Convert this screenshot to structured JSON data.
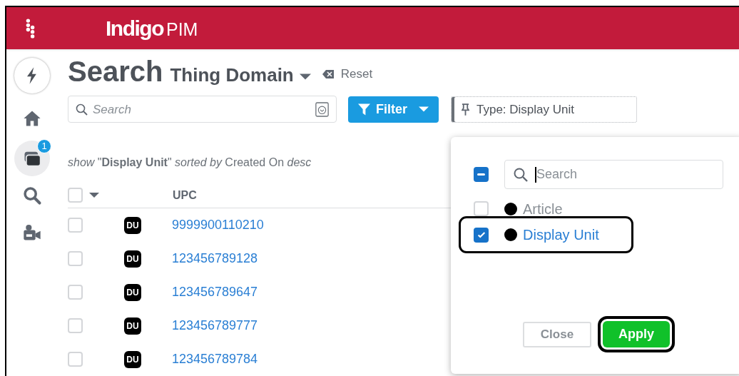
{
  "header": {
    "logo": "Indigo",
    "product": "PIM"
  },
  "sidebar": {
    "items": [
      {
        "kind": "bolt",
        "selected": false
      },
      {
        "kind": "home",
        "selected": false
      },
      {
        "kind": "cards",
        "selected": true,
        "badge": "1"
      },
      {
        "kind": "search",
        "selected": false
      },
      {
        "kind": "camera",
        "selected": false
      }
    ]
  },
  "page": {
    "title": "Search",
    "domain": "Thing Domain",
    "reset": "Reset"
  },
  "search": {
    "placeholder": "Search"
  },
  "filter_button": "Filter",
  "filter_chip": "Type: Display Unit",
  "summary": "*show* \"**Display Unit**\" *sorted by* Created On *desc*",
  "table": {
    "select_all_checked": false,
    "columns": [
      "UPC"
    ],
    "rows": [
      {
        "checked": false,
        "badge": "DU",
        "upc": "9999900110210"
      },
      {
        "checked": false,
        "badge": "DU",
        "upc": "123456789128"
      },
      {
        "checked": false,
        "badge": "DU",
        "upc": "123456789647"
      },
      {
        "checked": false,
        "badge": "DU",
        "upc": "123456789777"
      },
      {
        "checked": false,
        "badge": "DU",
        "upc": "123456789784"
      }
    ]
  },
  "popup": {
    "select_all_indeterminate": true,
    "search": {
      "placeholder": "Search",
      "focused": true
    },
    "options": [
      {
        "label": "Article",
        "checked": false,
        "highlighted": false
      },
      {
        "label": "Display Unit",
        "checked": true,
        "highlighted": true
      }
    ],
    "buttons": [
      {
        "kind": "close",
        "label": "Close",
        "highlighted": false
      },
      {
        "kind": "apply",
        "label": "Apply",
        "highlighted": true
      }
    ]
  }
}
